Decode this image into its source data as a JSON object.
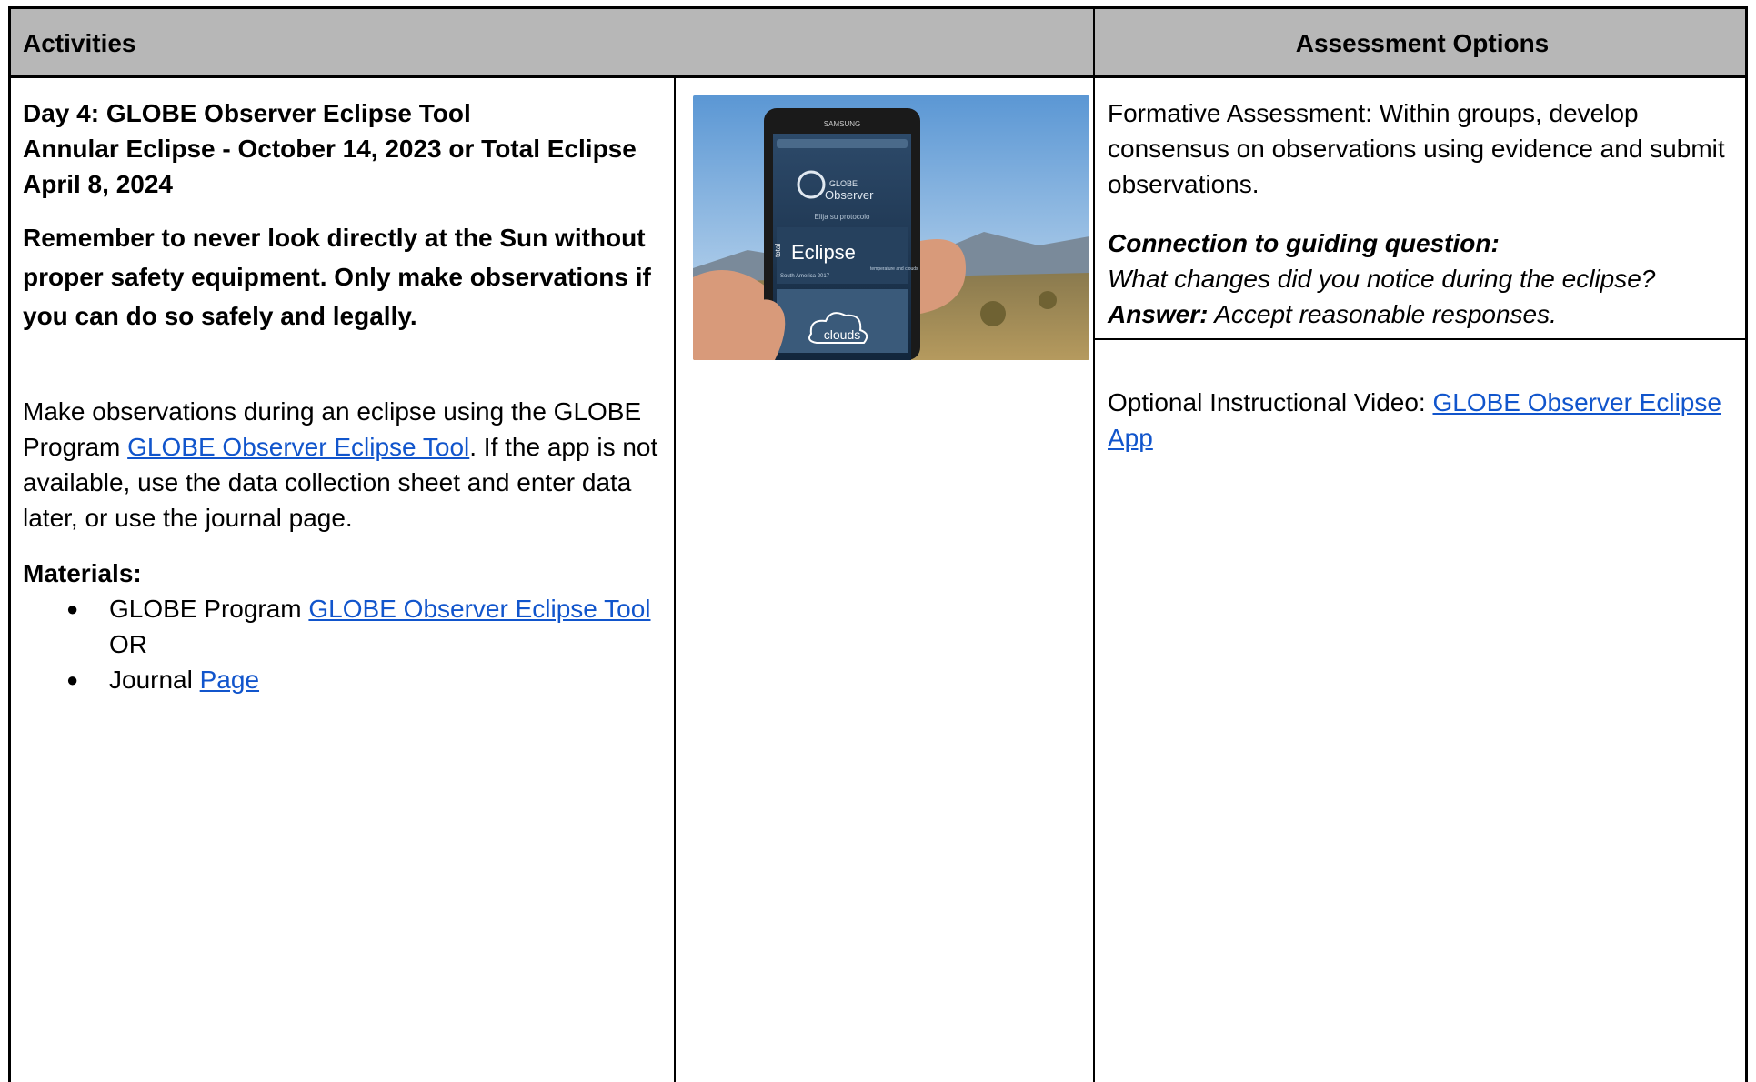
{
  "header": {
    "activities": "Activities",
    "assessment": "Assessment Options"
  },
  "activities": {
    "title_line1": "Day 4: GLOBE Observer Eclipse Tool",
    "title_line2": "Annular Eclipse - October 14, 2023 or Total Eclipse April 8, 2024",
    "warning": "Remember to never look directly at the Sun without proper safety equipment. Only make observations if you can do so safely and legally.",
    "body_part1": "Make observations during an eclipse using the GLOBE Program ",
    "body_link": "GLOBE Observer Eclipse Tool",
    "body_part2": ". If the app is not available, use the data collection sheet and enter data later,  or use the journal page.",
    "materials_label": "Materials:",
    "materials": [
      {
        "prefix": "GLOBE Program ",
        "link": "GLOBE Observer Eclipse Tool",
        "suffix": " OR"
      },
      {
        "prefix": "Journal ",
        "link": "Page",
        "suffix": ""
      }
    ]
  },
  "photo": {
    "phone_brand": "SAMSUNG",
    "app_globe": "GLOBE",
    "app_observer": "Observer",
    "app_subtitle": "Elija su protocolo",
    "eclipse_total": "total",
    "eclipse_word": "Eclipse",
    "eclipse_region": "South America 2017",
    "eclipse_caption": "temperature and clouds",
    "clouds_word": "clouds"
  },
  "assessment": {
    "formative": "Formative Assessment: Within groups, develop consensus on observations using evidence and submit observations.",
    "connection_label": "Connection to guiding question:",
    "connection_question": "What changes did you notice during the eclipse?",
    "answer_label": "Answer:",
    "answer_text": " Accept reasonable responses.",
    "video_prefix": "Optional Instructional Video: ",
    "video_link": "GLOBE Observer Eclipse App"
  },
  "colors": {
    "header_bg": "#b7b7b7",
    "link": "#1155cc",
    "border": "#000000"
  }
}
